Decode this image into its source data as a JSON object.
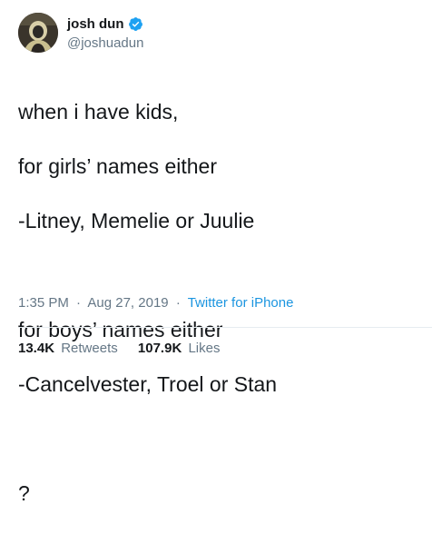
{
  "tweet": {
    "author": {
      "display_name": "josh dun",
      "handle": "@joshuadun",
      "verified": true,
      "avatar_icon": "profile-photo"
    },
    "text_lines": [
      "when i have kids,",
      "for girls’ names either",
      "-Litney, Memelie or Juulie",
      "",
      "for boys’ names either",
      "-Cancelvester, Troel or Stan",
      "",
      "?"
    ],
    "time": "1:35 PM",
    "date": "Aug 27, 2019",
    "separator": "·",
    "source": "Twitter for iPhone",
    "stats": {
      "retweets_count": "13.4K",
      "retweets_label": "Retweets",
      "likes_count": "107.9K",
      "likes_label": "Likes"
    }
  },
  "colors": {
    "text": "#14171a",
    "secondary": "#657786",
    "link": "#1b95e0",
    "verified": "#1da1f2",
    "divider": "#e6ecf0"
  }
}
